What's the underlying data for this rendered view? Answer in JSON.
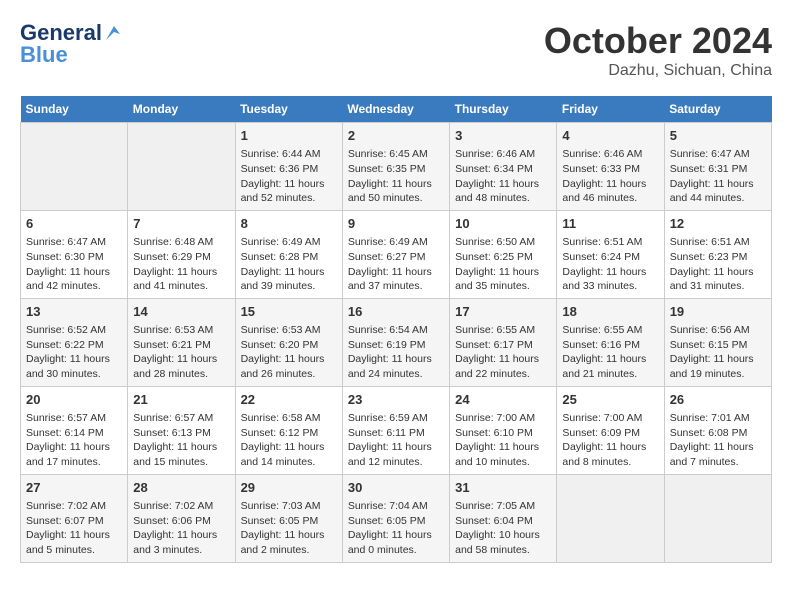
{
  "header": {
    "logo_line1": "General",
    "logo_line2": "Blue",
    "month": "October 2024",
    "location": "Dazhu, Sichuan, China"
  },
  "weekdays": [
    "Sunday",
    "Monday",
    "Tuesday",
    "Wednesday",
    "Thursday",
    "Friday",
    "Saturday"
  ],
  "weeks": [
    [
      {
        "day": "",
        "info": ""
      },
      {
        "day": "",
        "info": ""
      },
      {
        "day": "1",
        "info": "Sunrise: 6:44 AM\nSunset: 6:36 PM\nDaylight: 11 hours and 52 minutes."
      },
      {
        "day": "2",
        "info": "Sunrise: 6:45 AM\nSunset: 6:35 PM\nDaylight: 11 hours and 50 minutes."
      },
      {
        "day": "3",
        "info": "Sunrise: 6:46 AM\nSunset: 6:34 PM\nDaylight: 11 hours and 48 minutes."
      },
      {
        "day": "4",
        "info": "Sunrise: 6:46 AM\nSunset: 6:33 PM\nDaylight: 11 hours and 46 minutes."
      },
      {
        "day": "5",
        "info": "Sunrise: 6:47 AM\nSunset: 6:31 PM\nDaylight: 11 hours and 44 minutes."
      }
    ],
    [
      {
        "day": "6",
        "info": "Sunrise: 6:47 AM\nSunset: 6:30 PM\nDaylight: 11 hours and 42 minutes."
      },
      {
        "day": "7",
        "info": "Sunrise: 6:48 AM\nSunset: 6:29 PM\nDaylight: 11 hours and 41 minutes."
      },
      {
        "day": "8",
        "info": "Sunrise: 6:49 AM\nSunset: 6:28 PM\nDaylight: 11 hours and 39 minutes."
      },
      {
        "day": "9",
        "info": "Sunrise: 6:49 AM\nSunset: 6:27 PM\nDaylight: 11 hours and 37 minutes."
      },
      {
        "day": "10",
        "info": "Sunrise: 6:50 AM\nSunset: 6:25 PM\nDaylight: 11 hours and 35 minutes."
      },
      {
        "day": "11",
        "info": "Sunrise: 6:51 AM\nSunset: 6:24 PM\nDaylight: 11 hours and 33 minutes."
      },
      {
        "day": "12",
        "info": "Sunrise: 6:51 AM\nSunset: 6:23 PM\nDaylight: 11 hours and 31 minutes."
      }
    ],
    [
      {
        "day": "13",
        "info": "Sunrise: 6:52 AM\nSunset: 6:22 PM\nDaylight: 11 hours and 30 minutes."
      },
      {
        "day": "14",
        "info": "Sunrise: 6:53 AM\nSunset: 6:21 PM\nDaylight: 11 hours and 28 minutes."
      },
      {
        "day": "15",
        "info": "Sunrise: 6:53 AM\nSunset: 6:20 PM\nDaylight: 11 hours and 26 minutes."
      },
      {
        "day": "16",
        "info": "Sunrise: 6:54 AM\nSunset: 6:19 PM\nDaylight: 11 hours and 24 minutes."
      },
      {
        "day": "17",
        "info": "Sunrise: 6:55 AM\nSunset: 6:17 PM\nDaylight: 11 hours and 22 minutes."
      },
      {
        "day": "18",
        "info": "Sunrise: 6:55 AM\nSunset: 6:16 PM\nDaylight: 11 hours and 21 minutes."
      },
      {
        "day": "19",
        "info": "Sunrise: 6:56 AM\nSunset: 6:15 PM\nDaylight: 11 hours and 19 minutes."
      }
    ],
    [
      {
        "day": "20",
        "info": "Sunrise: 6:57 AM\nSunset: 6:14 PM\nDaylight: 11 hours and 17 minutes."
      },
      {
        "day": "21",
        "info": "Sunrise: 6:57 AM\nSunset: 6:13 PM\nDaylight: 11 hours and 15 minutes."
      },
      {
        "day": "22",
        "info": "Sunrise: 6:58 AM\nSunset: 6:12 PM\nDaylight: 11 hours and 14 minutes."
      },
      {
        "day": "23",
        "info": "Sunrise: 6:59 AM\nSunset: 6:11 PM\nDaylight: 11 hours and 12 minutes."
      },
      {
        "day": "24",
        "info": "Sunrise: 7:00 AM\nSunset: 6:10 PM\nDaylight: 11 hours and 10 minutes."
      },
      {
        "day": "25",
        "info": "Sunrise: 7:00 AM\nSunset: 6:09 PM\nDaylight: 11 hours and 8 minutes."
      },
      {
        "day": "26",
        "info": "Sunrise: 7:01 AM\nSunset: 6:08 PM\nDaylight: 11 hours and 7 minutes."
      }
    ],
    [
      {
        "day": "27",
        "info": "Sunrise: 7:02 AM\nSunset: 6:07 PM\nDaylight: 11 hours and 5 minutes."
      },
      {
        "day": "28",
        "info": "Sunrise: 7:02 AM\nSunset: 6:06 PM\nDaylight: 11 hours and 3 minutes."
      },
      {
        "day": "29",
        "info": "Sunrise: 7:03 AM\nSunset: 6:05 PM\nDaylight: 11 hours and 2 minutes."
      },
      {
        "day": "30",
        "info": "Sunrise: 7:04 AM\nSunset: 6:05 PM\nDaylight: 11 hours and 0 minutes."
      },
      {
        "day": "31",
        "info": "Sunrise: 7:05 AM\nSunset: 6:04 PM\nDaylight: 10 hours and 58 minutes."
      },
      {
        "day": "",
        "info": ""
      },
      {
        "day": "",
        "info": ""
      }
    ]
  ]
}
